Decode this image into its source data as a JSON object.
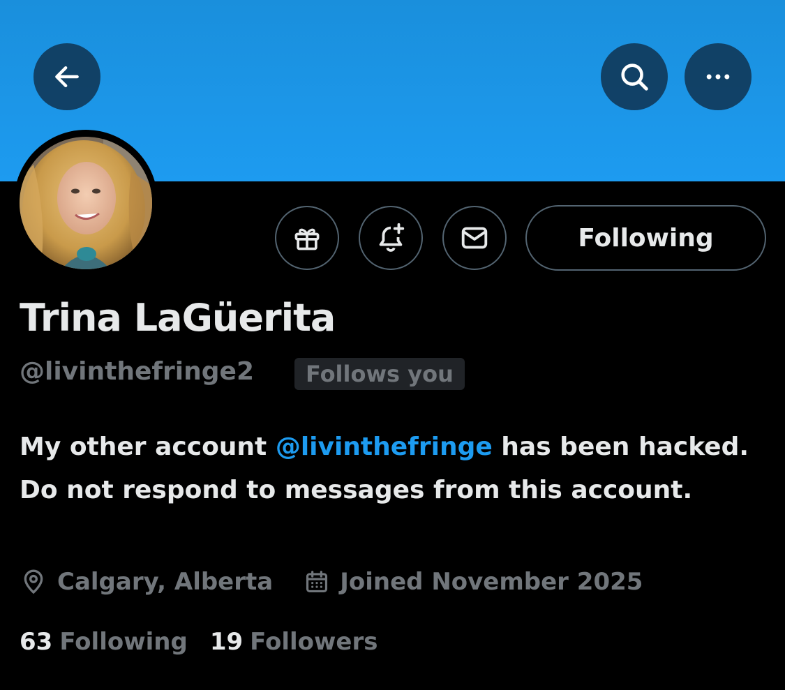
{
  "colors": {
    "banner": "#1d9bf0",
    "background": "#000000",
    "text_primary": "#e7e9ea",
    "text_secondary": "#71767b",
    "link": "#1d9bf0"
  },
  "header": {
    "back_icon": "arrow-left-icon",
    "search_icon": "search-icon",
    "more_icon": "more-horizontal-icon"
  },
  "actions": {
    "gift_icon": "gift-icon",
    "notify_icon": "bell-plus-icon",
    "message_icon": "envelope-icon",
    "following_label": "Following"
  },
  "profile": {
    "display_name": "Trina LaGüerita",
    "handle": "@livinthefringe2",
    "follows_you_badge": "Follows you",
    "bio": {
      "part1": "My other account ",
      "mention": "@livinthefringe",
      "part2": " has been hacked. Do not respond to messages from this account."
    },
    "location": "Calgary, Alberta",
    "joined": "Joined November 2025",
    "following_count": "63",
    "following_label": "Following",
    "followers_count": "19",
    "followers_label": "Followers"
  }
}
